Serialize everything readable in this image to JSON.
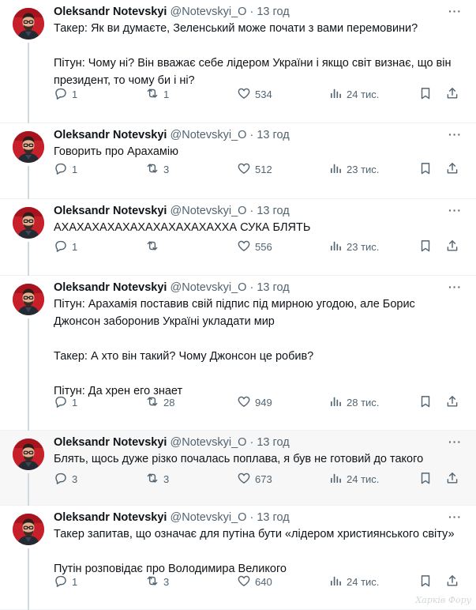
{
  "author": {
    "name": "Oleksandr Notevskyi",
    "handle": "@Notevskyi_O",
    "separator": "·"
  },
  "icons": {
    "reply": "reply-icon",
    "retweet": "retweet-icon",
    "like": "heart-icon",
    "views": "views-chart-icon",
    "bookmark": "bookmark-icon",
    "share": "share-icon",
    "more": "more-dots-icon"
  },
  "more_label": "···",
  "tweets": [
    {
      "time": "13 год",
      "lines": [
        "Такер: Як ви думаєте, Зеленський може почати з вами перемовини?",
        "",
        "Пітун: Чому ні? Він вважає себе лідером України і якщо світ визнає, що він",
        "президент, то чому би і ні?"
      ],
      "replies": "1",
      "retweets": "1",
      "likes": "534",
      "views": "24 тис."
    },
    {
      "time": "13 год",
      "lines": [
        "Говорить про Арахамію"
      ],
      "replies": "1",
      "retweets": "3",
      "likes": "512",
      "views": "23 тис."
    },
    {
      "time": "13 год",
      "lines": [
        "АХАХАХАХАХАХАХАХАХАХАХХА СУКА БЛЯТЬ"
      ],
      "replies": "1",
      "retweets": "",
      "likes": "556",
      "views": "23 тис."
    },
    {
      "time": "13 год",
      "lines": [
        "Пітун: Арахамія поставив свій підпис під мирною угодою, але Борис",
        "Джонсон заборонив Україні укладати мир",
        "",
        "Такер: А хто він такий? Чому Джонсон це робив?",
        "",
        "Пітун: Да хрен его знает"
      ],
      "replies": "1",
      "retweets": "28",
      "likes": "949",
      "views": "28 тис."
    },
    {
      "time": "13 год",
      "lines": [
        "Блять, щось дуже різко почалась поплава, я був не готовий до такого"
      ],
      "replies": "3",
      "retweets": "3",
      "likes": "673",
      "views": "24 тис."
    },
    {
      "time": "13 год",
      "lines": [
        "Такер запитав, що означає для путіна бути «лідером християнського світу»",
        "",
        "Путін розповідає про Володимира Великого"
      ],
      "replies": "1",
      "retweets": "3",
      "likes": "640",
      "views": "24 тис."
    }
  ],
  "watermark": "Харків Фору"
}
